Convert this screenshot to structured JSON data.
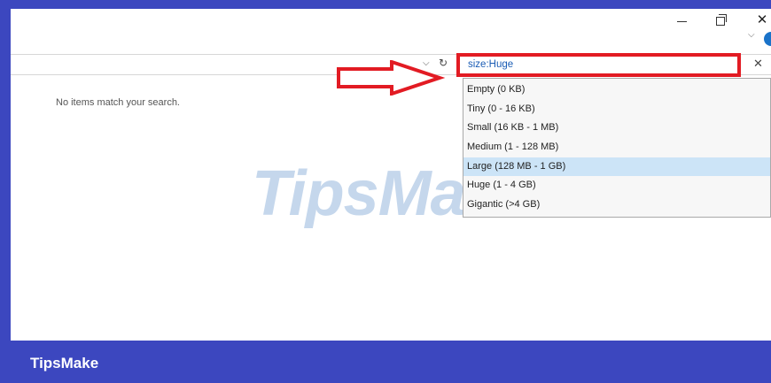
{
  "window": {
    "minimize_icon": "minimize-icon",
    "restore_icon": "restore-icon",
    "close_icon": "close-icon",
    "close_glyph": "✕"
  },
  "address_bar": {
    "dropdown_glyph": "⌵",
    "refresh_glyph": "↻"
  },
  "search": {
    "value": "size:Huge",
    "clear_glyph": "✕"
  },
  "main": {
    "empty_message": "No items match your search."
  },
  "suggestions": {
    "items": [
      "Empty (0 KB)",
      "Tiny (0 - 16 KB)",
      "Small (16 KB - 1 MB)",
      "Medium (1 - 128 MB)",
      "Large (128 MB - 1 GB)",
      "Huge (1 - 4 GB)",
      "Gigantic (>4 GB)"
    ],
    "selected": "Large (128 MB - 1 GB)"
  },
  "watermark": {
    "text": "TipsMake"
  },
  "footer": {
    "brand": "TipsMake"
  },
  "colors": {
    "banner": "#3c47bf",
    "highlight": "#e21b23",
    "selected_row": "#cce4f7",
    "search_text": "#1a5cb5"
  }
}
